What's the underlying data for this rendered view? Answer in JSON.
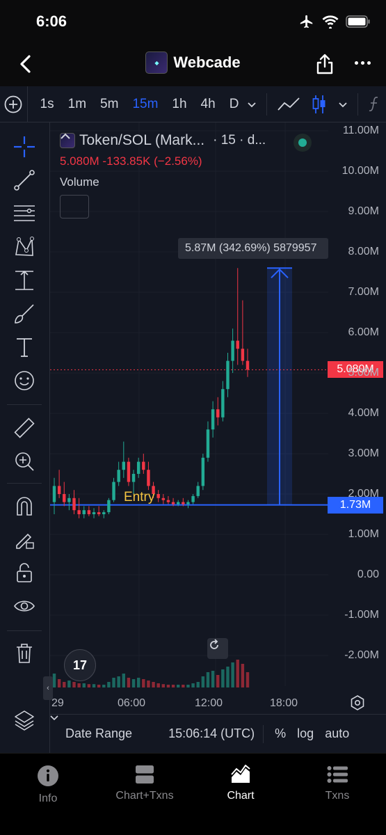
{
  "status_bar": {
    "time": "6:06"
  },
  "nav": {
    "title": "Webcade"
  },
  "toolbar": {
    "intervals": [
      "1s",
      "1m",
      "5m",
      "15m",
      "1h",
      "4h",
      "D"
    ],
    "active_interval": "15m"
  },
  "chart": {
    "symbol": "Token/SOL (Mark...",
    "symbol_suffix": "· 15 · d...",
    "price_line": "5.080M -133.85K (−2.56%)",
    "volume_label": "Volume",
    "measure_label": "5.87M (342.69%) 5879957",
    "entry_label": "Entry",
    "current_price": "5.080M",
    "entry_price": "1.73M",
    "date_range": "Date Range",
    "time_utc": "15:06:14 (UTC)",
    "pct": "%",
    "log": "log",
    "auto": "auto",
    "tv_logo": "17",
    "colors": {
      "up": "#22ab94",
      "down": "#f23645",
      "accent": "#2962ff",
      "entry": "#f5c542"
    }
  },
  "chart_data": {
    "type": "candlestick",
    "title": "",
    "y_ticks": [
      "11.00M",
      "10.00M",
      "9.00M",
      "8.00M",
      "7.00M",
      "6.00M",
      "5.00M",
      "4.00M",
      "3.00M",
      "2.00M",
      "1.00M",
      "0.00",
      "-1.00M",
      "-2.00M"
    ],
    "x_ticks": [
      "29",
      "06:00",
      "12:00",
      "18:00"
    ],
    "ylim": [
      -2.6,
      11.2
    ],
    "current_price": 5.08,
    "entry_price": 1.73,
    "measure": {
      "from": 1.73,
      "to": 7.6,
      "change": "5.87M",
      "change_pct": "342.69%"
    },
    "ohlc": [
      [
        1.8,
        2.4,
        1.5,
        2.2
      ],
      [
        2.2,
        2.6,
        1.9,
        2.0
      ],
      [
        2.0,
        2.3,
        1.7,
        1.8
      ],
      [
        1.8,
        2.0,
        1.6,
        1.9
      ],
      [
        1.9,
        2.1,
        1.5,
        1.6
      ],
      [
        1.6,
        1.9,
        1.4,
        1.5
      ],
      [
        1.5,
        1.7,
        1.4,
        1.6
      ],
      [
        1.6,
        1.7,
        1.45,
        1.5
      ],
      [
        1.5,
        1.65,
        1.4,
        1.55
      ],
      [
        1.55,
        1.7,
        1.45,
        1.5
      ],
      [
        1.5,
        1.6,
        1.4,
        1.55
      ],
      [
        1.55,
        1.9,
        1.5,
        1.85
      ],
      [
        1.85,
        2.4,
        1.8,
        2.3
      ],
      [
        2.3,
        2.8,
        2.2,
        2.6
      ],
      [
        2.6,
        3.3,
        2.4,
        2.8
      ],
      [
        2.8,
        2.9,
        2.2,
        2.3
      ],
      [
        2.3,
        2.6,
        2.0,
        2.5
      ],
      [
        2.5,
        2.9,
        2.4,
        2.8
      ],
      [
        2.8,
        3.0,
        2.5,
        2.6
      ],
      [
        2.6,
        2.8,
        2.1,
        2.2
      ],
      [
        2.2,
        2.3,
        1.9,
        2.0
      ],
      [
        2.0,
        2.1,
        1.8,
        1.9
      ],
      [
        1.9,
        2.0,
        1.75,
        1.85
      ],
      [
        1.85,
        1.95,
        1.75,
        1.8
      ],
      [
        1.8,
        1.9,
        1.7,
        1.75
      ],
      [
        1.75,
        1.85,
        1.7,
        1.8
      ],
      [
        1.8,
        1.9,
        1.7,
        1.75
      ],
      [
        1.75,
        1.85,
        1.65,
        1.8
      ],
      [
        1.8,
        2.0,
        1.75,
        1.95
      ],
      [
        1.95,
        2.3,
        1.9,
        2.2
      ],
      [
        2.2,
        3.0,
        2.1,
        2.9
      ],
      [
        2.9,
        3.8,
        2.8,
        3.6
      ],
      [
        3.6,
        4.3,
        3.4,
        4.1
      ],
      [
        4.1,
        4.4,
        3.7,
        3.9
      ],
      [
        3.9,
        4.8,
        3.8,
        4.6
      ],
      [
        4.6,
        5.5,
        4.4,
        5.3
      ],
      [
        5.3,
        6.1,
        5.0,
        5.8
      ],
      [
        5.8,
        7.6,
        5.2,
        5.6
      ],
      [
        5.6,
        6.8,
        5.2,
        5.3
      ],
      [
        5.3,
        5.6,
        4.9,
        5.08
      ]
    ],
    "volume": [
      0.5,
      0.3,
      0.2,
      0.25,
      0.2,
      0.15,
      0.15,
      0.12,
      0.12,
      0.1,
      0.1,
      0.2,
      0.35,
      0.4,
      0.5,
      0.35,
      0.3,
      0.35,
      0.3,
      0.25,
      0.2,
      0.15,
      0.12,
      0.1,
      0.1,
      0.1,
      0.1,
      0.1,
      0.15,
      0.2,
      0.4,
      0.55,
      0.6,
      0.45,
      0.65,
      0.75,
      0.9,
      1.0,
      0.85,
      0.55
    ]
  },
  "tabs": [
    {
      "label": "Info"
    },
    {
      "label": "Chart+Txns"
    },
    {
      "label": "Chart"
    },
    {
      "label": "Txns"
    }
  ]
}
